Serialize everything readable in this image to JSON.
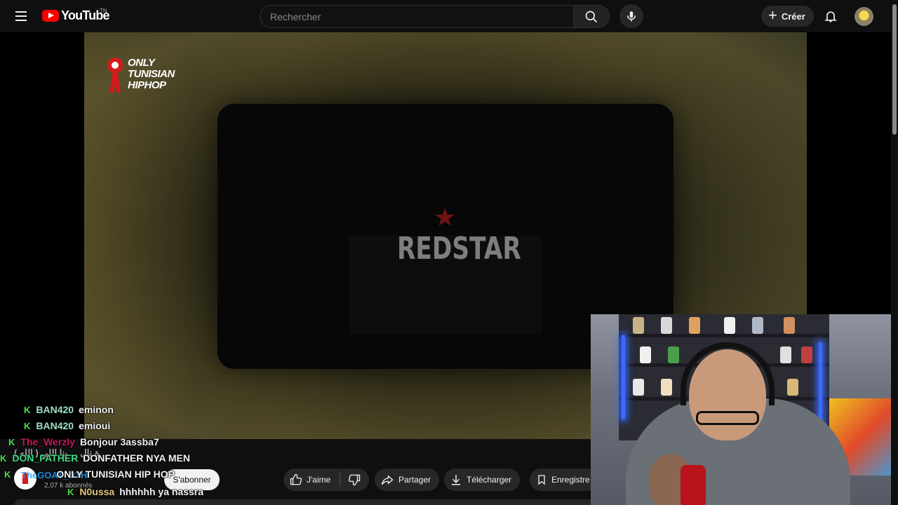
{
  "header": {
    "logo_text": "YouTube",
    "logo_country": "TN",
    "search_placeholder": "Rechercher",
    "create_label": "Créer"
  },
  "video": {
    "overlay_logo_lines": [
      "ONLY",
      "TUNISIAN",
      "HIPHOP"
    ],
    "center_title": "REDSTAR"
  },
  "channel": {
    "name": "TheGOAT_OTH",
    "subscribers": "2,07 k abonnés",
    "subscribe_label": "S'abonner"
  },
  "actions": {
    "like_label": "J'aime",
    "share_label": "Partager",
    "download_label": "Télécharger",
    "save_label": "Enregistre"
  },
  "chat": {
    "badge": "K",
    "messages": [
      {
        "user": "BAN420",
        "text": "eminon",
        "color": "#9fe0c0"
      },
      {
        "user": "BAN420",
        "text": "emioui",
        "color": "#9fe0c0"
      },
      {
        "user": "The_Werzly",
        "text": "Bonjour 3assba7",
        "color": "#c2185b"
      },
      {
        "user": "DON_FATHER",
        "text": "DONFATHER NYA MEN",
        "color": "#3ddc84"
      },
      {
        "user": "",
        "text": "ONLY TUNISIAN HIP HOP",
        "color": "#f1f1f1"
      },
      {
        "user": "N0ussa",
        "text": "hhhhhh ya nassra",
        "color": "#e6c77a"
      }
    ],
    "overlay_arabic": "( الله ) ة نال ... ينا اللي"
  },
  "colors": {
    "background": "#0f0f0f",
    "accent_red": "#ff0000",
    "pill_bg": "#272727"
  },
  "icons": [
    "menu-icon",
    "search-icon",
    "mic-icon",
    "plus-icon",
    "bell-icon",
    "like-icon",
    "dislike-icon",
    "share-icon",
    "download-icon",
    "bookmark-icon"
  ]
}
